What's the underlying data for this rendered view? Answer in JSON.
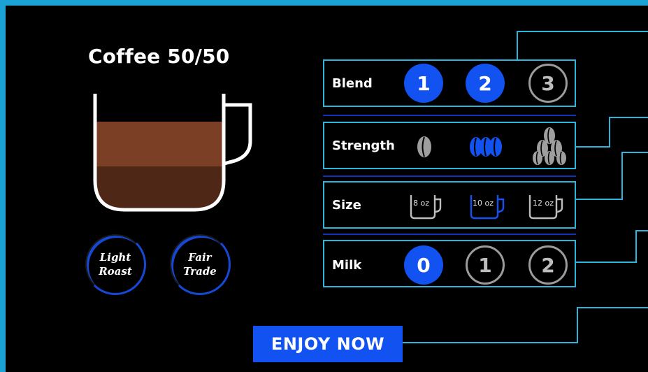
{
  "title": "Coffee 50/50",
  "badges": {
    "light_roast": [
      "Light",
      "Roast"
    ],
    "fair_trade": [
      "Fair",
      "Trade"
    ]
  },
  "blend": {
    "label": "Blend",
    "options": [
      "1",
      "2",
      "3"
    ],
    "selected": [
      "1",
      "2"
    ]
  },
  "strength": {
    "label": "Strength",
    "options": [
      "mild",
      "medium",
      "strong"
    ],
    "selected": "medium"
  },
  "size": {
    "label": "Size",
    "options": [
      "8 oz",
      "10 oz",
      "12 oz"
    ],
    "selected": "10 oz"
  },
  "milk": {
    "label": "Milk",
    "options": [
      "0",
      "1",
      "2"
    ],
    "selected": "0"
  },
  "action": {
    "enjoy_label": "ENJOY NOW"
  },
  "colors": {
    "accent": "#1152f0",
    "frame": "#1aa3d4",
    "panel_border": "#2cb6dd"
  }
}
